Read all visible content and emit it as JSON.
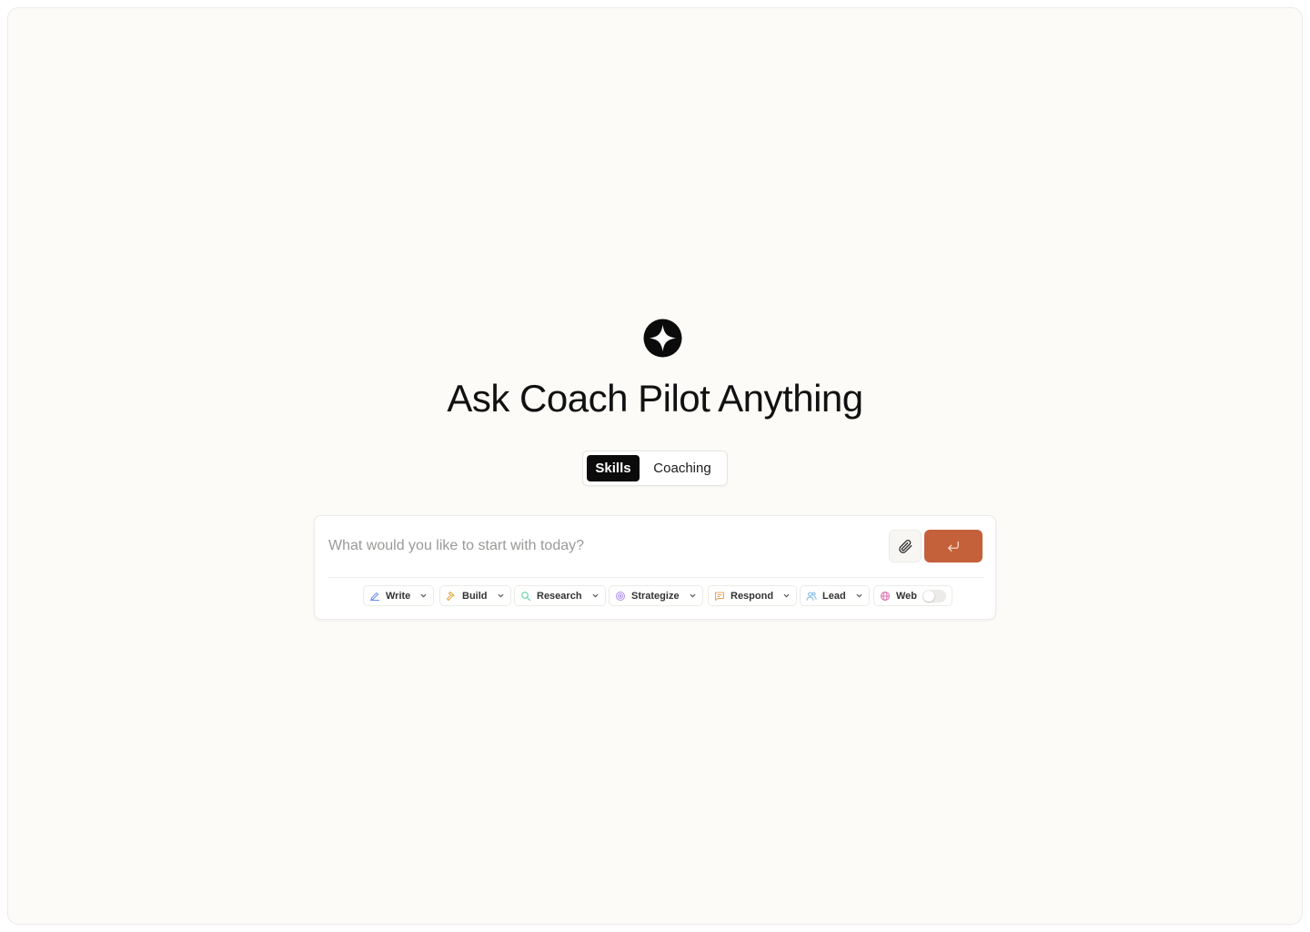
{
  "hero": {
    "logo_icon": "sparkle-icon",
    "title": "Ask Coach Pilot Anything"
  },
  "mode_switch": {
    "options": [
      "Skills",
      "Coaching"
    ],
    "selected": "Skills"
  },
  "composer": {
    "placeholder": "What would you like to start with today?",
    "attach_icon": "paperclip-icon",
    "send_icon": "enter-icon",
    "send_color": "#c4603a"
  },
  "skills": [
    {
      "label": "Write",
      "icon": "pen-icon",
      "color": "#6b8cf0"
    },
    {
      "label": "Build",
      "icon": "hammer-icon",
      "color": "#e0a33c"
    },
    {
      "label": "Research",
      "icon": "search-icon",
      "color": "#4fcf9a"
    },
    {
      "label": "Strategize",
      "icon": "target-icon",
      "color": "#b28df0"
    },
    {
      "label": "Respond",
      "icon": "message-icon",
      "color": "#f0a050"
    },
    {
      "label": "Lead",
      "icon": "users-icon",
      "color": "#7bb8e8"
    }
  ],
  "web_toggle": {
    "label": "Web",
    "icon": "globe-icon",
    "color": "#e06aa8",
    "enabled": false
  }
}
